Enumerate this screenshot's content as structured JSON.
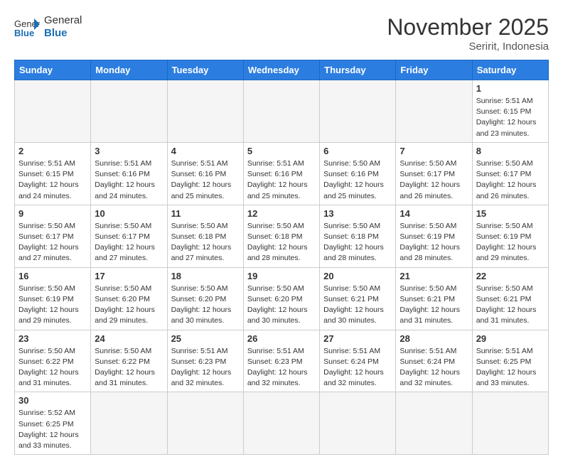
{
  "header": {
    "logo_general": "General",
    "logo_blue": "Blue",
    "month_title": "November 2025",
    "subtitle": "Seririt, Indonesia"
  },
  "days_of_week": [
    "Sunday",
    "Monday",
    "Tuesday",
    "Wednesday",
    "Thursday",
    "Friday",
    "Saturday"
  ],
  "weeks": [
    [
      {
        "day": "",
        "info": ""
      },
      {
        "day": "",
        "info": ""
      },
      {
        "day": "",
        "info": ""
      },
      {
        "day": "",
        "info": ""
      },
      {
        "day": "",
        "info": ""
      },
      {
        "day": "",
        "info": ""
      },
      {
        "day": "1",
        "info": "Sunrise: 5:51 AM\nSunset: 6:15 PM\nDaylight: 12 hours\nand 23 minutes."
      }
    ],
    [
      {
        "day": "2",
        "info": "Sunrise: 5:51 AM\nSunset: 6:15 PM\nDaylight: 12 hours\nand 24 minutes."
      },
      {
        "day": "3",
        "info": "Sunrise: 5:51 AM\nSunset: 6:16 PM\nDaylight: 12 hours\nand 24 minutes."
      },
      {
        "day": "4",
        "info": "Sunrise: 5:51 AM\nSunset: 6:16 PM\nDaylight: 12 hours\nand 25 minutes."
      },
      {
        "day": "5",
        "info": "Sunrise: 5:51 AM\nSunset: 6:16 PM\nDaylight: 12 hours\nand 25 minutes."
      },
      {
        "day": "6",
        "info": "Sunrise: 5:50 AM\nSunset: 6:16 PM\nDaylight: 12 hours\nand 25 minutes."
      },
      {
        "day": "7",
        "info": "Sunrise: 5:50 AM\nSunset: 6:17 PM\nDaylight: 12 hours\nand 26 minutes."
      },
      {
        "day": "8",
        "info": "Sunrise: 5:50 AM\nSunset: 6:17 PM\nDaylight: 12 hours\nand 26 minutes."
      }
    ],
    [
      {
        "day": "9",
        "info": "Sunrise: 5:50 AM\nSunset: 6:17 PM\nDaylight: 12 hours\nand 27 minutes."
      },
      {
        "day": "10",
        "info": "Sunrise: 5:50 AM\nSunset: 6:17 PM\nDaylight: 12 hours\nand 27 minutes."
      },
      {
        "day": "11",
        "info": "Sunrise: 5:50 AM\nSunset: 6:18 PM\nDaylight: 12 hours\nand 27 minutes."
      },
      {
        "day": "12",
        "info": "Sunrise: 5:50 AM\nSunset: 6:18 PM\nDaylight: 12 hours\nand 28 minutes."
      },
      {
        "day": "13",
        "info": "Sunrise: 5:50 AM\nSunset: 6:18 PM\nDaylight: 12 hours\nand 28 minutes."
      },
      {
        "day": "14",
        "info": "Sunrise: 5:50 AM\nSunset: 6:19 PM\nDaylight: 12 hours\nand 28 minutes."
      },
      {
        "day": "15",
        "info": "Sunrise: 5:50 AM\nSunset: 6:19 PM\nDaylight: 12 hours\nand 29 minutes."
      }
    ],
    [
      {
        "day": "16",
        "info": "Sunrise: 5:50 AM\nSunset: 6:19 PM\nDaylight: 12 hours\nand 29 minutes."
      },
      {
        "day": "17",
        "info": "Sunrise: 5:50 AM\nSunset: 6:20 PM\nDaylight: 12 hours\nand 29 minutes."
      },
      {
        "day": "18",
        "info": "Sunrise: 5:50 AM\nSunset: 6:20 PM\nDaylight: 12 hours\nand 30 minutes."
      },
      {
        "day": "19",
        "info": "Sunrise: 5:50 AM\nSunset: 6:20 PM\nDaylight: 12 hours\nand 30 minutes."
      },
      {
        "day": "20",
        "info": "Sunrise: 5:50 AM\nSunset: 6:21 PM\nDaylight: 12 hours\nand 30 minutes."
      },
      {
        "day": "21",
        "info": "Sunrise: 5:50 AM\nSunset: 6:21 PM\nDaylight: 12 hours\nand 31 minutes."
      },
      {
        "day": "22",
        "info": "Sunrise: 5:50 AM\nSunset: 6:21 PM\nDaylight: 12 hours\nand 31 minutes."
      }
    ],
    [
      {
        "day": "23",
        "info": "Sunrise: 5:50 AM\nSunset: 6:22 PM\nDaylight: 12 hours\nand 31 minutes."
      },
      {
        "day": "24",
        "info": "Sunrise: 5:50 AM\nSunset: 6:22 PM\nDaylight: 12 hours\nand 31 minutes."
      },
      {
        "day": "25",
        "info": "Sunrise: 5:51 AM\nSunset: 6:23 PM\nDaylight: 12 hours\nand 32 minutes."
      },
      {
        "day": "26",
        "info": "Sunrise: 5:51 AM\nSunset: 6:23 PM\nDaylight: 12 hours\nand 32 minutes."
      },
      {
        "day": "27",
        "info": "Sunrise: 5:51 AM\nSunset: 6:24 PM\nDaylight: 12 hours\nand 32 minutes."
      },
      {
        "day": "28",
        "info": "Sunrise: 5:51 AM\nSunset: 6:24 PM\nDaylight: 12 hours\nand 32 minutes."
      },
      {
        "day": "29",
        "info": "Sunrise: 5:51 AM\nSunset: 6:25 PM\nDaylight: 12 hours\nand 33 minutes."
      }
    ],
    [
      {
        "day": "30",
        "info": "Sunrise: 5:52 AM\nSunset: 6:25 PM\nDaylight: 12 hours\nand 33 minutes."
      },
      {
        "day": "",
        "info": ""
      },
      {
        "day": "",
        "info": ""
      },
      {
        "day": "",
        "info": ""
      },
      {
        "day": "",
        "info": ""
      },
      {
        "day": "",
        "info": ""
      },
      {
        "day": "",
        "info": ""
      }
    ]
  ]
}
